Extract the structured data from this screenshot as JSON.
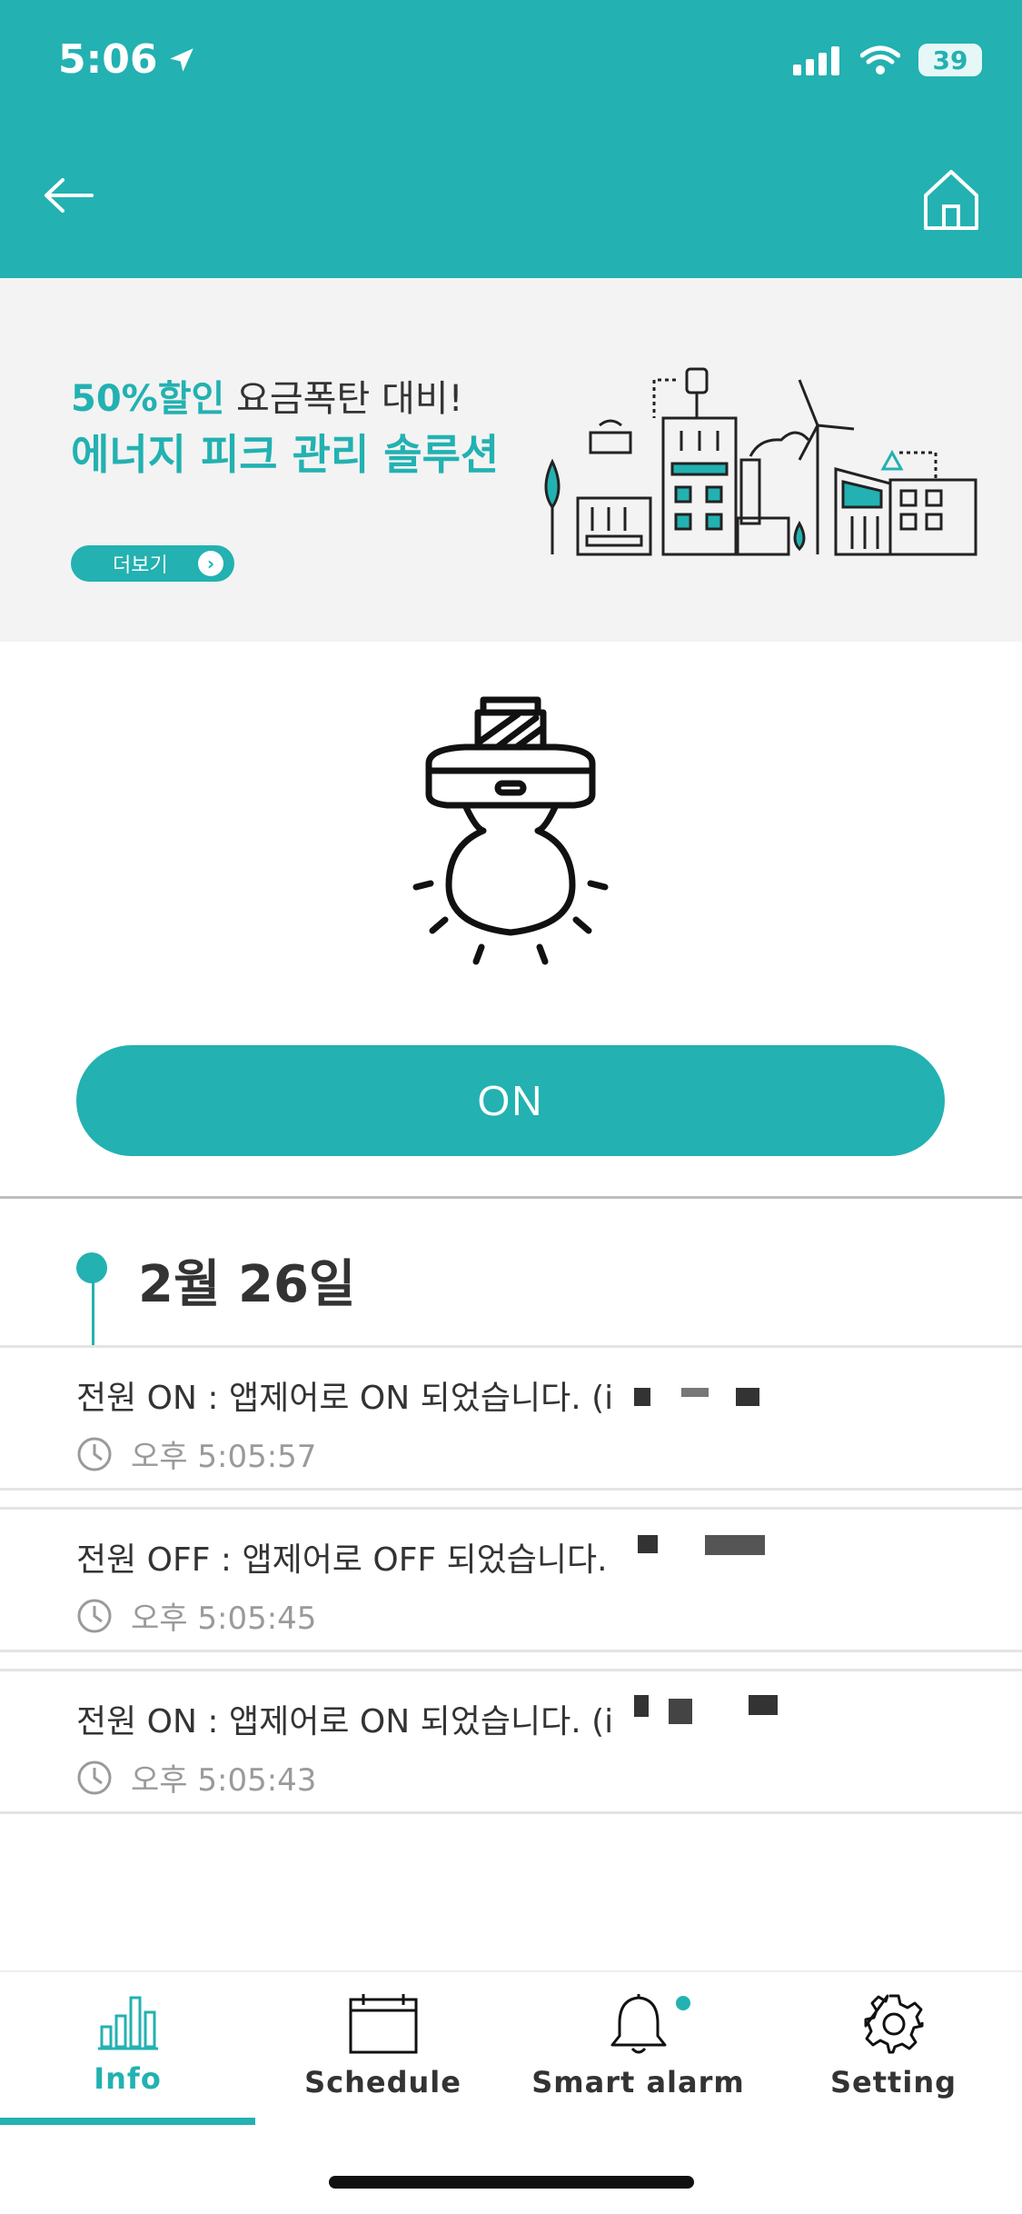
{
  "status_bar": {
    "time": "5:06",
    "battery": "39"
  },
  "header": {
    "title": "",
    "back_icon": "arrow-left-icon",
    "home_icon": "home-icon"
  },
  "banner": {
    "line1_accent": "50%할인",
    "line1_rest": " 요금폭탄 대비!",
    "line2": "에너지 피크 관리 솔루션",
    "more_label": "더보기"
  },
  "device": {
    "bulb_icon": "light-bulb-icon",
    "power_button_label": "ON"
  },
  "history": {
    "date": "2월 26일",
    "logs": [
      {
        "text": "전원 ON : 앱제어로 ON 되었습니다. (i",
        "time": "오후 5:05:57"
      },
      {
        "text": "전원 OFF : 앱제어로 OFF 되었습니다.",
        "time": "오후 5:05:45"
      },
      {
        "text": "전원 ON : 앱제어로 ON 되었습니다. (i",
        "time": "오후 5:05:43"
      }
    ]
  },
  "bottom_nav": {
    "items": [
      {
        "label": "Info",
        "icon": "bar-chart-icon",
        "active": true
      },
      {
        "label": "Schedule",
        "icon": "calendar-icon",
        "active": false
      },
      {
        "label": "Smart alarm",
        "icon": "bell-icon",
        "active": false
      },
      {
        "label": "Setting",
        "icon": "gear-icon",
        "active": false
      }
    ]
  },
  "colors": {
    "accent": "#23b1b1",
    "text": "#333333",
    "muted": "#9a9a9a",
    "banner_bg": "#f3f3f3"
  }
}
